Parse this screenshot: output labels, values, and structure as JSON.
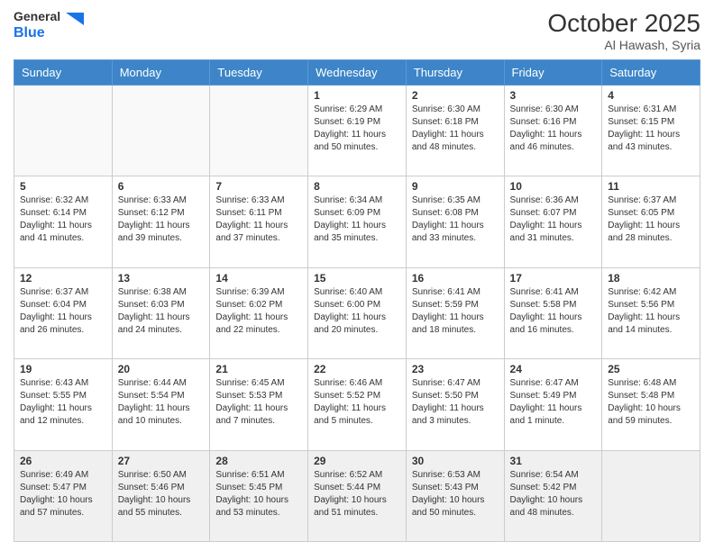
{
  "header": {
    "logo_general": "General",
    "logo_blue": "Blue",
    "month_title": "October 2025",
    "location": "Al Hawash, Syria"
  },
  "days_of_week": [
    "Sunday",
    "Monday",
    "Tuesday",
    "Wednesday",
    "Thursday",
    "Friday",
    "Saturday"
  ],
  "weeks": [
    [
      {
        "day": "",
        "info": ""
      },
      {
        "day": "",
        "info": ""
      },
      {
        "day": "",
        "info": ""
      },
      {
        "day": "1",
        "info": "Sunrise: 6:29 AM\nSunset: 6:19 PM\nDaylight: 11 hours\nand 50 minutes."
      },
      {
        "day": "2",
        "info": "Sunrise: 6:30 AM\nSunset: 6:18 PM\nDaylight: 11 hours\nand 48 minutes."
      },
      {
        "day": "3",
        "info": "Sunrise: 6:30 AM\nSunset: 6:16 PM\nDaylight: 11 hours\nand 46 minutes."
      },
      {
        "day": "4",
        "info": "Sunrise: 6:31 AM\nSunset: 6:15 PM\nDaylight: 11 hours\nand 43 minutes."
      }
    ],
    [
      {
        "day": "5",
        "info": "Sunrise: 6:32 AM\nSunset: 6:14 PM\nDaylight: 11 hours\nand 41 minutes."
      },
      {
        "day": "6",
        "info": "Sunrise: 6:33 AM\nSunset: 6:12 PM\nDaylight: 11 hours\nand 39 minutes."
      },
      {
        "day": "7",
        "info": "Sunrise: 6:33 AM\nSunset: 6:11 PM\nDaylight: 11 hours\nand 37 minutes."
      },
      {
        "day": "8",
        "info": "Sunrise: 6:34 AM\nSunset: 6:09 PM\nDaylight: 11 hours\nand 35 minutes."
      },
      {
        "day": "9",
        "info": "Sunrise: 6:35 AM\nSunset: 6:08 PM\nDaylight: 11 hours\nand 33 minutes."
      },
      {
        "day": "10",
        "info": "Sunrise: 6:36 AM\nSunset: 6:07 PM\nDaylight: 11 hours\nand 31 minutes."
      },
      {
        "day": "11",
        "info": "Sunrise: 6:37 AM\nSunset: 6:05 PM\nDaylight: 11 hours\nand 28 minutes."
      }
    ],
    [
      {
        "day": "12",
        "info": "Sunrise: 6:37 AM\nSunset: 6:04 PM\nDaylight: 11 hours\nand 26 minutes."
      },
      {
        "day": "13",
        "info": "Sunrise: 6:38 AM\nSunset: 6:03 PM\nDaylight: 11 hours\nand 24 minutes."
      },
      {
        "day": "14",
        "info": "Sunrise: 6:39 AM\nSunset: 6:02 PM\nDaylight: 11 hours\nand 22 minutes."
      },
      {
        "day": "15",
        "info": "Sunrise: 6:40 AM\nSunset: 6:00 PM\nDaylight: 11 hours\nand 20 minutes."
      },
      {
        "day": "16",
        "info": "Sunrise: 6:41 AM\nSunset: 5:59 PM\nDaylight: 11 hours\nand 18 minutes."
      },
      {
        "day": "17",
        "info": "Sunrise: 6:41 AM\nSunset: 5:58 PM\nDaylight: 11 hours\nand 16 minutes."
      },
      {
        "day": "18",
        "info": "Sunrise: 6:42 AM\nSunset: 5:56 PM\nDaylight: 11 hours\nand 14 minutes."
      }
    ],
    [
      {
        "day": "19",
        "info": "Sunrise: 6:43 AM\nSunset: 5:55 PM\nDaylight: 11 hours\nand 12 minutes."
      },
      {
        "day": "20",
        "info": "Sunrise: 6:44 AM\nSunset: 5:54 PM\nDaylight: 11 hours\nand 10 minutes."
      },
      {
        "day": "21",
        "info": "Sunrise: 6:45 AM\nSunset: 5:53 PM\nDaylight: 11 hours\nand 7 minutes."
      },
      {
        "day": "22",
        "info": "Sunrise: 6:46 AM\nSunset: 5:52 PM\nDaylight: 11 hours\nand 5 minutes."
      },
      {
        "day": "23",
        "info": "Sunrise: 6:47 AM\nSunset: 5:50 PM\nDaylight: 11 hours\nand 3 minutes."
      },
      {
        "day": "24",
        "info": "Sunrise: 6:47 AM\nSunset: 5:49 PM\nDaylight: 11 hours\nand 1 minute."
      },
      {
        "day": "25",
        "info": "Sunrise: 6:48 AM\nSunset: 5:48 PM\nDaylight: 10 hours\nand 59 minutes."
      }
    ],
    [
      {
        "day": "26",
        "info": "Sunrise: 6:49 AM\nSunset: 5:47 PM\nDaylight: 10 hours\nand 57 minutes."
      },
      {
        "day": "27",
        "info": "Sunrise: 6:50 AM\nSunset: 5:46 PM\nDaylight: 10 hours\nand 55 minutes."
      },
      {
        "day": "28",
        "info": "Sunrise: 6:51 AM\nSunset: 5:45 PM\nDaylight: 10 hours\nand 53 minutes."
      },
      {
        "day": "29",
        "info": "Sunrise: 6:52 AM\nSunset: 5:44 PM\nDaylight: 10 hours\nand 51 minutes."
      },
      {
        "day": "30",
        "info": "Sunrise: 6:53 AM\nSunset: 5:43 PM\nDaylight: 10 hours\nand 50 minutes."
      },
      {
        "day": "31",
        "info": "Sunrise: 6:54 AM\nSunset: 5:42 PM\nDaylight: 10 hours\nand 48 minutes."
      },
      {
        "day": "",
        "info": ""
      }
    ]
  ]
}
